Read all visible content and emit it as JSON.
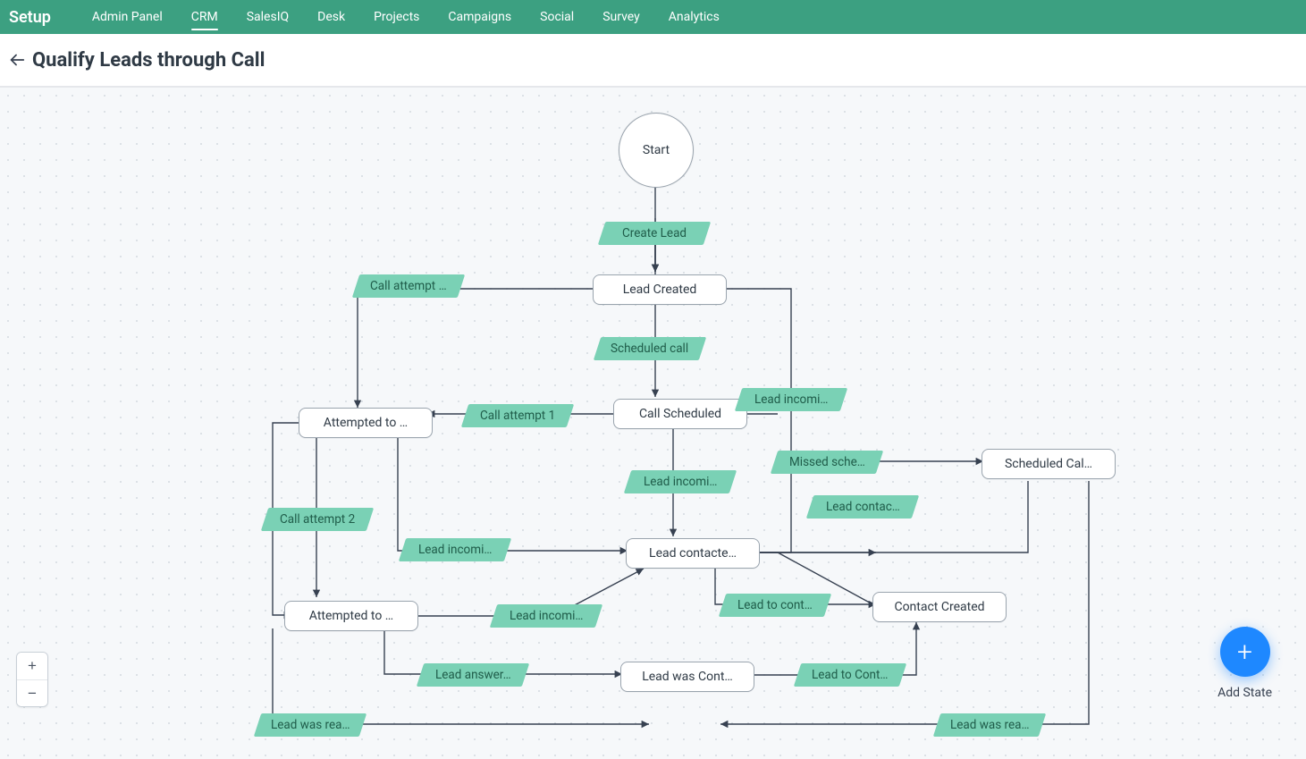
{
  "nav": {
    "brand": "Setup",
    "tabs": [
      {
        "label": "Admin Panel",
        "active": false
      },
      {
        "label": "CRM",
        "active": true
      },
      {
        "label": "SalesIQ",
        "active": false
      },
      {
        "label": "Desk",
        "active": false
      },
      {
        "label": "Projects",
        "active": false
      },
      {
        "label": "Campaigns",
        "active": false
      },
      {
        "label": "Social",
        "active": false
      },
      {
        "label": "Survey",
        "active": false
      },
      {
        "label": "Analytics",
        "active": false
      }
    ]
  },
  "page_title": "Qualify Leads through Call",
  "start_label": "Start",
  "add_state_label": "Add State",
  "zoom": {
    "plus": "+",
    "minus": "−"
  },
  "states": {
    "lead_created": "Lead Created",
    "call_scheduled": "Call Scheduled",
    "attempted1": "Attempted to …",
    "scheduled_missed": "Scheduled Cal…",
    "lead_contacted": "Lead contacte…",
    "attempted2": "Attempted to …",
    "contact_created": "Contact Created",
    "lead_was_cont": "Lead was Cont…"
  },
  "transitions": {
    "create_lead": "Create Lead",
    "attempt_top": "Call attempt …",
    "scheduled_call": "Scheduled call",
    "attempt1": "Call attempt 1",
    "incoming_top": "Lead incomi…",
    "missed_sched": "Missed sche…",
    "incoming_mid": "Lead incomi…",
    "lead_contac_r": "Lead contac…",
    "attempt2": "Call attempt 2",
    "incoming_left": "Lead incomi…",
    "incoming_low": "Lead incomi…",
    "lead_to_contS": "Lead to cont…",
    "lead_answer": "Lead answer…",
    "lead_to_contC": "Lead to Cont…",
    "reached_left": "Lead was rea…",
    "reached_right": "Lead was rea…"
  }
}
